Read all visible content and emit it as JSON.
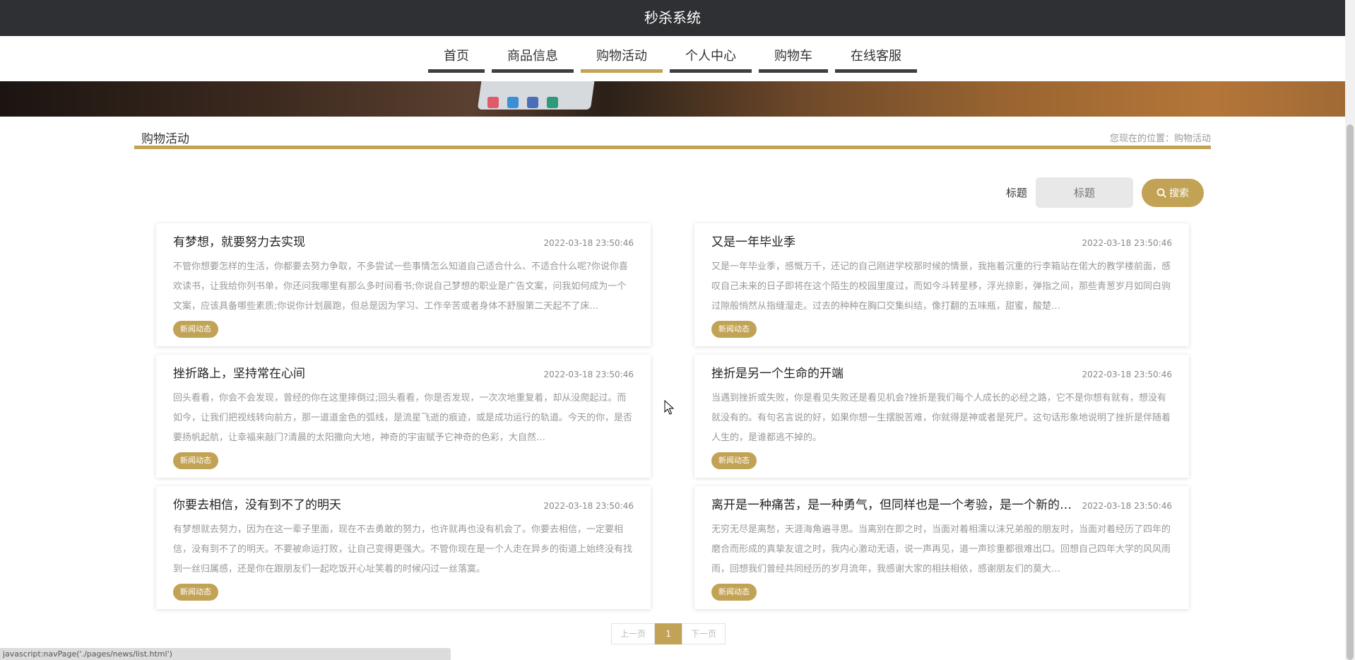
{
  "app": {
    "title": "秒杀系统"
  },
  "nav": [
    {
      "label": "首页",
      "active": false
    },
    {
      "label": "商品信息",
      "active": false
    },
    {
      "label": "购物活动",
      "active": true
    },
    {
      "label": "个人中心",
      "active": false
    },
    {
      "label": "购物车",
      "active": false
    },
    {
      "label": "在线客服",
      "active": false
    }
  ],
  "section": {
    "title": "购物活动",
    "breadcrumb": "您现在的位置：购物活动"
  },
  "search": {
    "label": "标题",
    "placeholder": "标题",
    "button_label": "搜索",
    "icon": "search-icon"
  },
  "cards": [
    {
      "title": "有梦想，就要努力去实现",
      "date": "2022-03-18 23:50:46",
      "excerpt": "不管你想要怎样的生活，你都要去努力争取，不多尝试一些事情怎么知道自己适合什么、不适合什么呢?你说你喜欢读书，让我给你列书单，你还问我哪里有那么多时间看书;你说自己梦想的职业是广告文案，问我如何成为一个文案，应该具备哪些素质;你说你计划晨跑，但总是因为学习、工作辛苦或者身体不舒服第二天起不了床…",
      "tag": "新闻动态"
    },
    {
      "title": "又是一年毕业季",
      "date": "2022-03-18 23:50:46",
      "excerpt": "又是一年毕业季，感慨万千，还记的自己刚进学校那时候的情景，我拖着沉重的行李箱站在偌大的教学楼前面，感叹自己未来的日子即将在这个陌生的校园里度过，而如今斗转星移，浮光掠影，弹指之间，那些青葱岁月如同白驹过隙般悄然从指缝溜走。过去的种种在胸口交集纠结，像打翻的五味瓶，甜蜜，酸楚…",
      "tag": "新闻动态"
    },
    {
      "title": "挫折路上，坚持常在心间",
      "date": "2022-03-18 23:50:46",
      "excerpt": "回头看看，你会不会发现，曾经的你在这里摔倒过;回头看看，你是否发现，一次次地重复着，却从没爬起过。而如今，让我们把视线转向前方，那一道道金色的弧线，是流星飞逝的痕迹，或是成功运行的轨道。今天的你，是否要扬帆起航，让幸福来敲门?清晨的太阳撒向大地，神奇的宇宙赋予它神奇的色彩，大自然…",
      "tag": "新闻动态"
    },
    {
      "title": "挫折是另一个生命的开端",
      "date": "2022-03-18 23:50:46",
      "excerpt": "当遇到挫折或失败，你是看见失败还是看见机会?挫折是我们每个人成长的必经之路，它不是你想有就有，想没有就没有的。有句名言说的好，如果你想一生摆脱苦难，你就得是神或者是死尸。这句话形象地说明了挫折是伴随着人生的，是谁都逃不掉的。",
      "tag": "新闻动态"
    },
    {
      "title": "你要去相信，没有到不了的明天",
      "date": "2022-03-18 23:50:46",
      "excerpt": "有梦想就去努力，因为在这一辈子里面，现在不去勇敢的努力，也许就再也没有机会了。你要去相信，一定要相信，没有到不了的明天。不要被命运打败，让自己变得更强大。不管你现在是一个人走在异乡的街道上始终没有找到一丝归属感，还是你在跟朋友们一起吃饭开心址笑着的时候闪过一丝落寞。",
      "tag": "新闻动态"
    },
    {
      "title": "离开是一种痛苦，是一种勇气，但同样也是一个考验，是一个新的开始",
      "date": "2022-03-18 23:50:46",
      "excerpt": "无穷无尽是离愁，天涯海角遍寻思。当离别在即之时，当面对着相濡以沫兄弟般的朋友时，当面对着经历了四年的磨合而形成的真挚友谊之时，我内心激动无语，说一声再见，道一声珍重都很难出口。回想自己四年大学的风风雨雨，回想我们曾经共同经历的岁月流年，我感谢大家的相扶相依，感谢朋友们的莫大…",
      "tag": "新闻动态"
    }
  ],
  "pager": {
    "prev": "上一页",
    "current": "1",
    "next": "下一页"
  },
  "status_url": "javascript:navPage('./pages/news/list.html')",
  "colors": {
    "accent": "#c2a254",
    "topbar": "#2e3033"
  }
}
